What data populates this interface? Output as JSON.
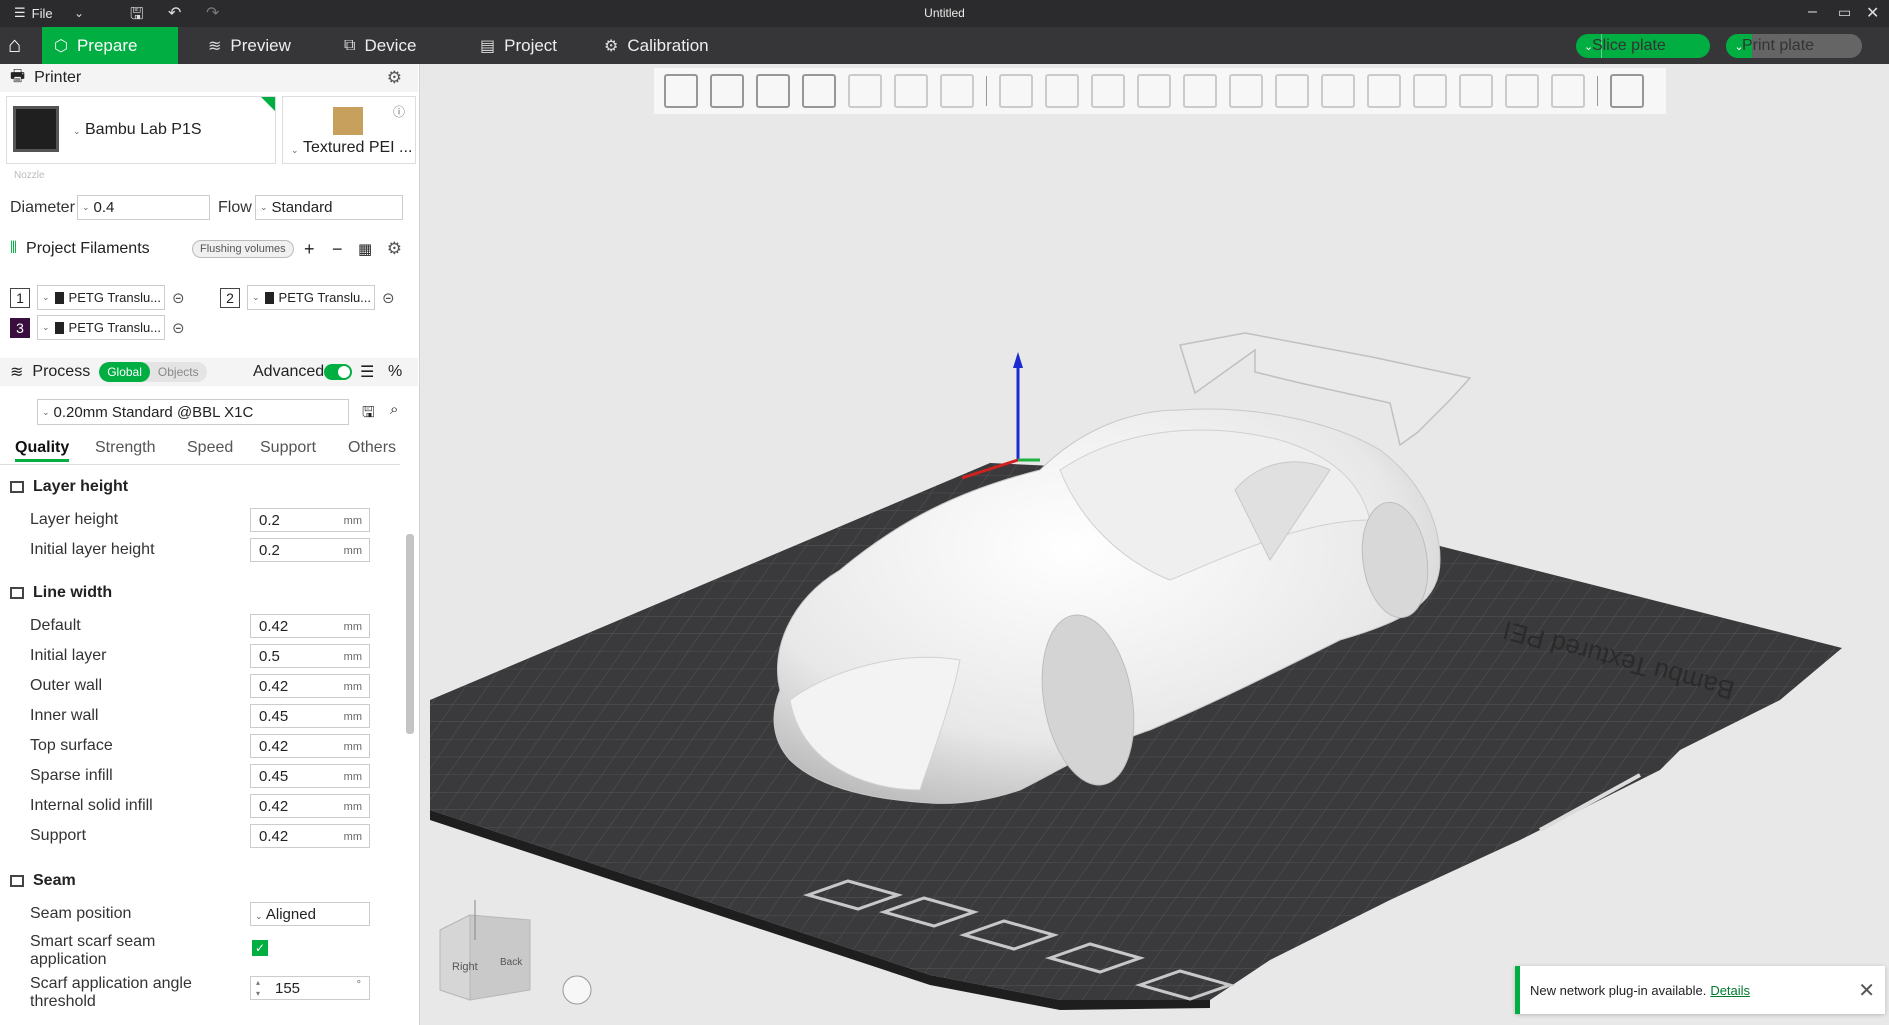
{
  "titlebar": {
    "file": "File",
    "title": "Untitled"
  },
  "nav": {
    "tabs": [
      {
        "label": "Prepare"
      },
      {
        "label": "Preview"
      },
      {
        "label": "Device"
      },
      {
        "label": "Project"
      },
      {
        "label": "Calibration"
      }
    ],
    "slice": "Slice plate",
    "print": "Print plate"
  },
  "printer": {
    "header": "Printer",
    "name": "Bambu Lab P1S",
    "plate": "Textured PEI ...",
    "nozzle": "Nozzle",
    "diameter_label": "Diameter",
    "diameter": "0.4",
    "flow_label": "Flow",
    "flow": "Standard"
  },
  "filaments": {
    "header": "Project Filaments",
    "flushing": "Flushing volumes",
    "items": [
      {
        "num": "1",
        "name": "PETG Translu..."
      },
      {
        "num": "2",
        "name": "PETG Translu..."
      },
      {
        "num": "3",
        "name": "PETG Translu..."
      }
    ]
  },
  "process": {
    "header": "Process",
    "global": "Global",
    "objects": "Objects",
    "advanced": "Advanced",
    "preset": "0.20mm Standard @BBL X1C",
    "tabs": [
      "Quality",
      "Strength",
      "Speed",
      "Support",
      "Others"
    ]
  },
  "quality": {
    "layer_height": {
      "title": "Layer height",
      "rows": [
        {
          "label": "Layer height",
          "value": "0.2",
          "unit": "mm"
        },
        {
          "label": "Initial layer height",
          "value": "0.2",
          "unit": "mm"
        }
      ]
    },
    "line_width": {
      "title": "Line width",
      "rows": [
        {
          "label": "Default",
          "value": "0.42",
          "unit": "mm"
        },
        {
          "label": "Initial layer",
          "value": "0.5",
          "unit": "mm"
        },
        {
          "label": "Outer wall",
          "value": "0.42",
          "unit": "mm"
        },
        {
          "label": "Inner wall",
          "value": "0.45",
          "unit": "mm"
        },
        {
          "label": "Top surface",
          "value": "0.42",
          "unit": "mm"
        },
        {
          "label": "Sparse infill",
          "value": "0.45",
          "unit": "mm"
        },
        {
          "label": "Internal solid infill",
          "value": "0.42",
          "unit": "mm"
        },
        {
          "label": "Support",
          "value": "0.42",
          "unit": "mm"
        }
      ]
    },
    "seam": {
      "title": "Seam",
      "position_label": "Seam position",
      "position": "Aligned",
      "scarf_label": "Smart scarf seam application",
      "angle_label": "Scarf application angle threshold",
      "angle": "155",
      "angle_unit": "°"
    }
  },
  "viewport": {
    "plate_text": "Bambu Textured PEI",
    "cube_right": "Right",
    "cube_back": "Back"
  },
  "notice": {
    "text": "New network plug-in available.",
    "link": "Details"
  },
  "colors": {
    "accent": "#00ae42",
    "bed": "#3a3a3c",
    "model": "#f2f2f2"
  }
}
